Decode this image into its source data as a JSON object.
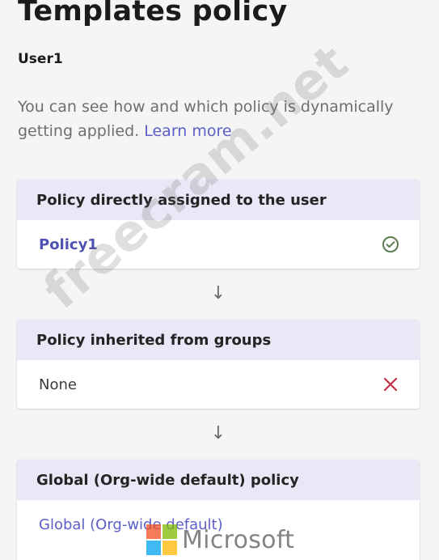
{
  "page": {
    "title": "Templates policy",
    "user": "User1",
    "description": "You can see how and which policy is dynamically getting applied.",
    "learn_more": "Learn more"
  },
  "cards": [
    {
      "header": "Policy directly assigned to the user",
      "value": "Policy1",
      "status_icon": "check-circle-icon",
      "status_color": "#5b7b52"
    },
    {
      "header": "Policy inherited from groups",
      "value": "None",
      "status_icon": "close-icon",
      "status_color": "#c4314b"
    },
    {
      "header": "Global (Org-wide default) policy",
      "value": "Global (Org-wide default)"
    }
  ],
  "arrows": {
    "glyph": "↓"
  },
  "overlays": {
    "watermark": "freecram.net",
    "logo_text": "Microsoft",
    "logo_colors": [
      "#f25022",
      "#7fba00",
      "#00a4ef",
      "#ffb900"
    ]
  },
  "colors": {
    "accent": "#5b5fc7",
    "header_bg": "#e8e8f7"
  }
}
